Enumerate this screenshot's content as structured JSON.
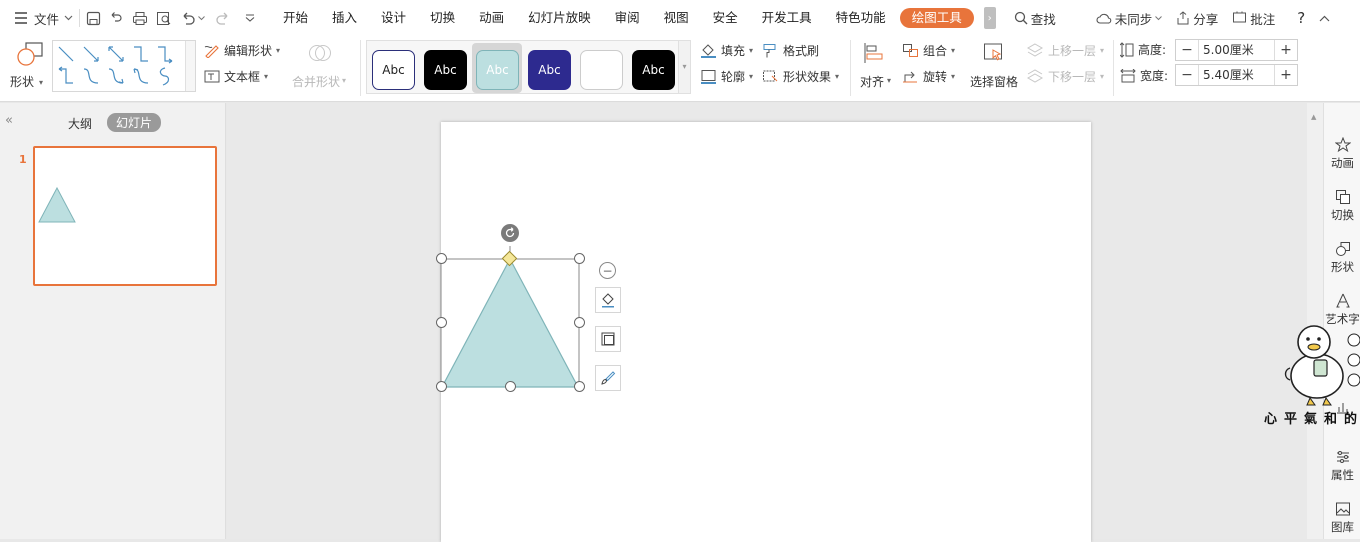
{
  "menubar": {
    "file_label": "文件",
    "tabs": [
      "开始",
      "插入",
      "设计",
      "切换",
      "动画",
      "幻灯片放映",
      "审阅",
      "视图",
      "安全",
      "开发工具",
      "特色功能"
    ],
    "active_tab": "绘图工具",
    "search_label": "查找",
    "sync_label": "未同步",
    "share_label": "分享",
    "comment_label": "批注",
    "help_label": "?"
  },
  "ribbon": {
    "shape_label": "形状",
    "edit_shape_label": "编辑形状",
    "textbox_label": "文本框",
    "merge_shape_label": "合并形状",
    "style_tiles": [
      "Abc",
      "Abc",
      "Abc",
      "Abc",
      "",
      "Abc"
    ],
    "fill_label": "填充",
    "format_painter_label": "格式刷",
    "outline_label": "轮廓",
    "shape_effect_label": "形状效果",
    "align_label": "对齐",
    "group_label": "组合",
    "rotate_label": "旋转",
    "selection_pane_label": "选择窗格",
    "bring_forward_label": "上移一层",
    "send_backward_label": "下移一层",
    "height_label": "高度:",
    "height_value": "5.00厘米",
    "width_label": "宽度:",
    "width_value": "5.40厘米",
    "minus": "−",
    "plus": "+"
  },
  "leftpanel": {
    "outline_tab": "大纲",
    "slides_tab": "幻灯片",
    "slide_number": "1",
    "collapse": "«"
  },
  "rightbar": {
    "animation": "动画",
    "transition": "切换",
    "shape": "形状",
    "art_text": "艺术字",
    "properties": "属性",
    "gallery": "图库"
  },
  "watermark_text": "心平氣和的",
  "colors": {
    "accent_orange": "#e8743b",
    "shape_fill": "#bcdfe0",
    "shape_outline": "#7fb4b8",
    "thumb_border": "#e8743b"
  }
}
